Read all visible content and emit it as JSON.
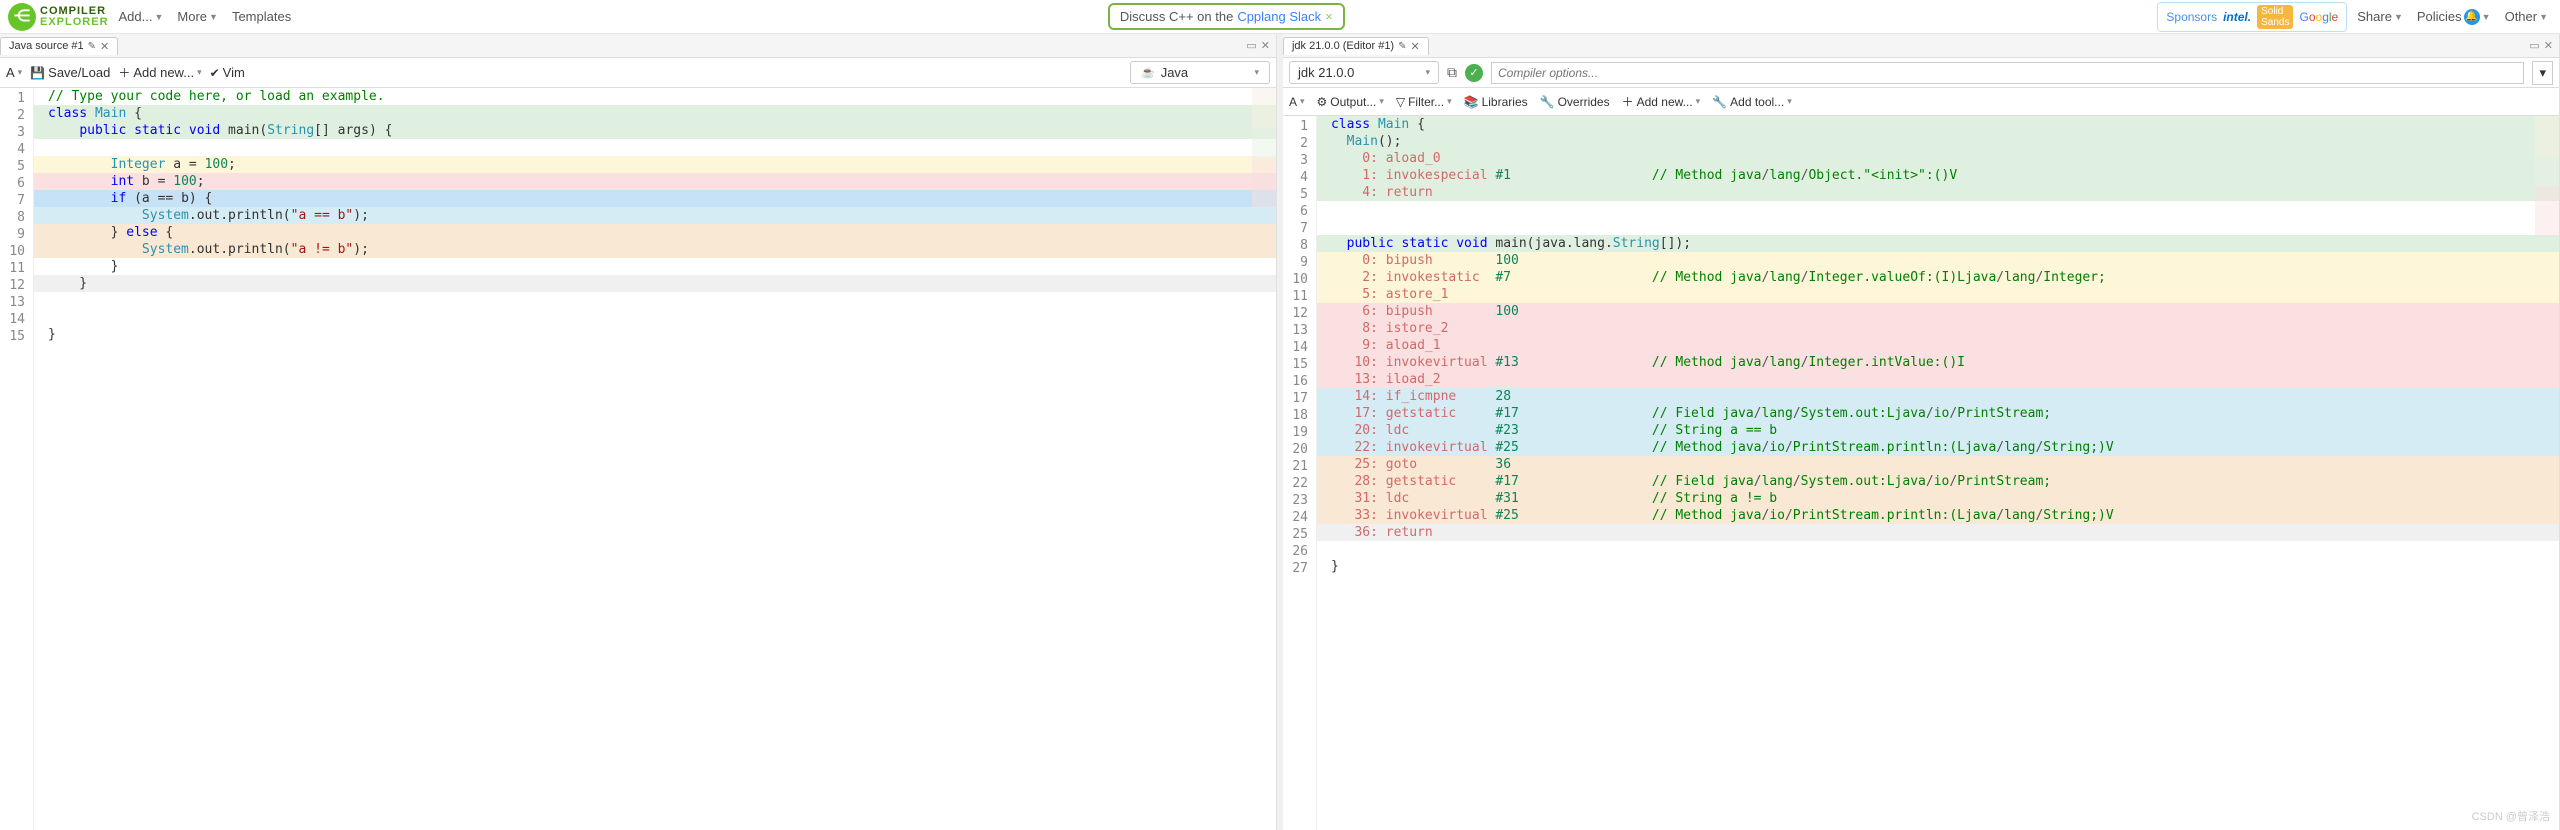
{
  "header": {
    "logo_top": "COMPILER",
    "logo_bot": "EXPLORER",
    "menu": {
      "add": "Add...",
      "more": "More",
      "templates": "Templates",
      "share": "Share",
      "policies": "Policies",
      "other": "Other"
    },
    "slack": {
      "prefix": "Discuss C++ on the ",
      "link": "Cpplang Slack",
      "close": "×"
    },
    "sponsors_label": "Sponsors"
  },
  "left": {
    "tab": "Java source #1",
    "toolbar": {
      "save": "Save/Load",
      "addnew": "Add new...",
      "vim": "Vim"
    },
    "lang": "Java",
    "code": [
      {
        "n": 1,
        "bg": "",
        "html": "<span class='c-comment'>// Type your code here, or load an example.</span>"
      },
      {
        "n": 2,
        "bg": "bg-green",
        "html": "<span class='c-kw'>class</span> <span class='c-type'>Main</span> {"
      },
      {
        "n": 3,
        "bg": "bg-green",
        "html": "    <span class='c-kw'>public</span> <span class='c-kw'>static</span> <span class='c-kw'>void</span> main(<span class='c-type'>String</span>[] args) {"
      },
      {
        "n": 4,
        "bg": "",
        "html": ""
      },
      {
        "n": 5,
        "bg": "bg-yellow",
        "html": "        <span class='c-type'>Integer</span> a = <span class='c-num'>100</span>;"
      },
      {
        "n": 6,
        "bg": "bg-red",
        "html": "        <span class='c-kw'>int</span> b = <span class='c-num'>100</span>;"
      },
      {
        "n": 7,
        "bg": "bg-sel",
        "html": "        <span class='c-kw'>if</span> (a == b) {"
      },
      {
        "n": 8,
        "bg": "bg-blue",
        "html": "            <span class='c-type'>System</span>.out.println(<span class='c-str'>\"a == b\"</span>);"
      },
      {
        "n": 9,
        "bg": "bg-peach",
        "html": "        } <span class='c-kw'>else</span> {"
      },
      {
        "n": 10,
        "bg": "bg-peach",
        "html": "            <span class='c-type'>System</span>.out.println(<span class='c-str'>\"a != b\"</span>);"
      },
      {
        "n": 11,
        "bg": "",
        "html": "        }"
      },
      {
        "n": 12,
        "bg": "bg-grey",
        "html": "    }"
      },
      {
        "n": 13,
        "bg": "",
        "html": ""
      },
      {
        "n": 14,
        "bg": "",
        "html": ""
      },
      {
        "n": 15,
        "bg": "",
        "html": "}"
      }
    ]
  },
  "right": {
    "tab": "jdk 21.0.0 (Editor #1)",
    "compiler": "jdk 21.0.0",
    "opts_placeholder": "Compiler options...",
    "toolbar": {
      "output": "Output...",
      "filter": "Filter...",
      "libs": "Libraries",
      "overrides": "Overrides",
      "addnew": "Add new...",
      "addtool": "Add tool..."
    },
    "asm": [
      {
        "n": 1,
        "bg": "bg-green",
        "html": "<span class='c-kw'>class</span> <span class='c-type'>Main</span> {"
      },
      {
        "n": 2,
        "bg": "bg-green",
        "html": "  <span class='c-type'>Main</span>();"
      },
      {
        "n": 3,
        "bg": "bg-green",
        "html": "    <span class='c-addr'>0:</span> <span class='c-op'>aload_0</span>"
      },
      {
        "n": 4,
        "bg": "bg-green",
        "html": "    <span class='c-addr'>1:</span> <span class='c-op'>invokespecial</span> <span class='c-ref'>#1</span>                  <span class='c-comment'>// Method java<span class='c-slash'>/</span>lang<span class='c-slash'>/</span>Object.\"&lt;init&gt;\":()V</span>"
      },
      {
        "n": 5,
        "bg": "bg-green",
        "html": "    <span class='c-addr'>4:</span> <span class='c-op'>return</span>"
      },
      {
        "n": 6,
        "bg": "",
        "html": ""
      },
      {
        "n": 7,
        "bg": "",
        "html": ""
      },
      {
        "n": 8,
        "bg": "bg-green",
        "html": "  <span class='c-kw'>public</span> <span class='c-kw'>static</span> <span class='c-kw'>void</span> main(java.lang.<span class='c-type'>String</span>[]);"
      },
      {
        "n": 9,
        "bg": "bg-yellow",
        "html": "    <span class='c-addr'>0:</span> <span class='c-op'>bipush</span>        <span class='c-ref'>100</span>"
      },
      {
        "n": 10,
        "bg": "bg-yellow",
        "html": "    <span class='c-addr'>2:</span> <span class='c-op'>invokestatic</span>  <span class='c-ref'>#7</span>                  <span class='c-comment'>// Method java<span class='c-slash'>/</span>lang<span class='c-slash'>/</span>Integer.valueOf:(I)Ljava<span class='c-slash'>/</span>lang<span class='c-slash'>/</span>Integer;</span>"
      },
      {
        "n": 11,
        "bg": "bg-yellow",
        "html": "    <span class='c-addr'>5:</span> <span class='c-op'>astore_1</span>"
      },
      {
        "n": 12,
        "bg": "bg-red",
        "html": "    <span class='c-addr'>6:</span> <span class='c-op'>bipush</span>        <span class='c-ref'>100</span>"
      },
      {
        "n": 13,
        "bg": "bg-red",
        "html": "    <span class='c-addr'>8:</span> <span class='c-op'>istore_2</span>"
      },
      {
        "n": 14,
        "bg": "bg-red",
        "html": "    <span class='c-addr'>9:</span> <span class='c-op'>aload_1</span>"
      },
      {
        "n": 15,
        "bg": "bg-red",
        "html": "   <span class='c-addr'>10:</span> <span class='c-op'>invokevirtual</span> <span class='c-ref'>#13</span>                 <span class='c-comment'>// Method java<span class='c-slash'>/</span>lang<span class='c-slash'>/</span>Integer.intValue:()I</span>"
      },
      {
        "n": 16,
        "bg": "bg-red",
        "html": "   <span class='c-addr'>13:</span> <span class='c-op'>iload_2</span>"
      },
      {
        "n": 17,
        "bg": "bg-blue",
        "html": "   <span class='c-addr'>14:</span> <span class='c-op'>if_icmpne</span>     <span class='c-ref'>28</span>"
      },
      {
        "n": 18,
        "bg": "bg-blue",
        "html": "   <span class='c-addr'>17:</span> <span class='c-op'>getstatic</span>     <span class='c-ref'>#17</span>                 <span class='c-comment'>// Field java<span class='c-slash'>/</span>lang<span class='c-slash'>/</span>System.out:Ljava<span class='c-slash'>/</span>io<span class='c-slash'>/</span>PrintStream;</span>"
      },
      {
        "n": 19,
        "bg": "bg-blue",
        "html": "   <span class='c-addr'>20:</span> <span class='c-op'>ldc</span>           <span class='c-ref'>#23</span>                 <span class='c-comment'>// String a == b</span>"
      },
      {
        "n": 20,
        "bg": "bg-blue",
        "html": "   <span class='c-addr'>22:</span> <span class='c-op'>invokevirtual</span> <span class='c-ref'>#25</span>                 <span class='c-comment'>// Method java<span class='c-slash'>/</span>io<span class='c-slash'>/</span>PrintStream.println:(Ljava<span class='c-slash'>/</span>lang<span class='c-slash'>/</span>String;)V</span>"
      },
      {
        "n": 21,
        "bg": "bg-peach",
        "html": "   <span class='c-addr'>25:</span> <span class='c-op'>goto</span>          <span class='c-ref'>36</span>"
      },
      {
        "n": 22,
        "bg": "bg-peach",
        "html": "   <span class='c-addr'>28:</span> <span class='c-op'>getstatic</span>     <span class='c-ref'>#17</span>                 <span class='c-comment'>// Field java<span class='c-slash'>/</span>lang<span class='c-slash'>/</span>System.out:Ljava<span class='c-slash'>/</span>io<span class='c-slash'>/</span>PrintStream;</span>"
      },
      {
        "n": 23,
        "bg": "bg-peach",
        "html": "   <span class='c-addr'>31:</span> <span class='c-op'>ldc</span>           <span class='c-ref'>#31</span>                 <span class='c-comment'>// String a != b</span>"
      },
      {
        "n": 24,
        "bg": "bg-peach",
        "html": "   <span class='c-addr'>33:</span> <span class='c-op'>invokevirtual</span> <span class='c-ref'>#25</span>                 <span class='c-comment'>// Method java<span class='c-slash'>/</span>io<span class='c-slash'>/</span>PrintStream.println:(Ljava<span class='c-slash'>/</span>lang<span class='c-slash'>/</span>String;)V</span>"
      },
      {
        "n": 25,
        "bg": "bg-grey",
        "html": "   <span class='c-addr'>36:</span> <span class='c-op'>return</span>"
      },
      {
        "n": 26,
        "bg": "",
        "html": ""
      },
      {
        "n": 27,
        "bg": "",
        "html": "}"
      }
    ]
  },
  "watermark": "CSDN @曾泽浩"
}
